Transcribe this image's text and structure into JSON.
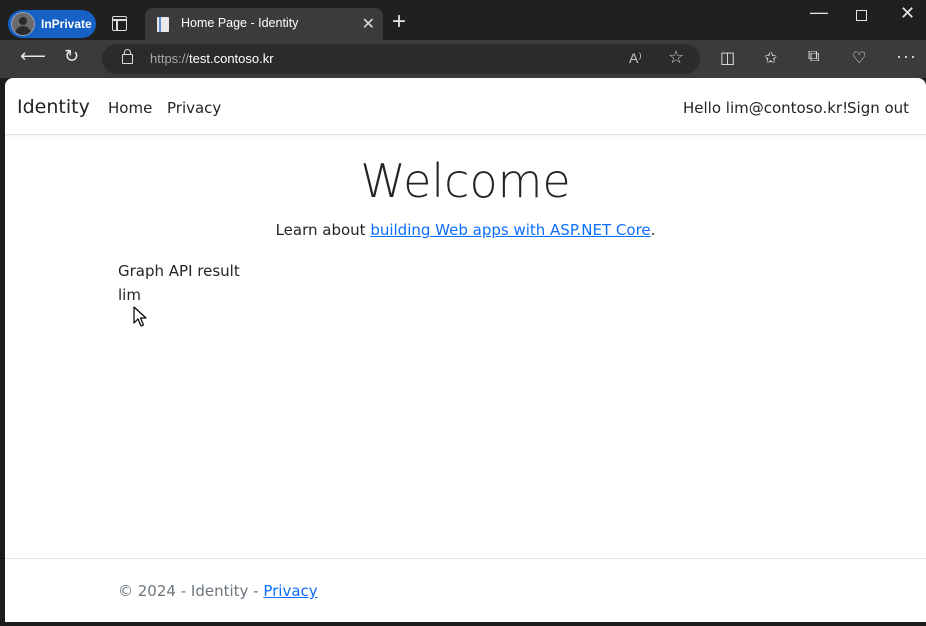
{
  "browser": {
    "inprivate_label": "InPrivate",
    "tab_title": "Home Page - Identity",
    "url_protocol": "https://",
    "url_host": "test.contoso.kr",
    "read_aloud_glyph": "A⁾"
  },
  "site": {
    "brand": "Identity",
    "nav": {
      "home": "Home",
      "privacy": "Privacy"
    },
    "greeting": "Hello lim@contoso.kr!",
    "signout": "Sign out"
  },
  "main": {
    "heading": "Welcome",
    "learn_prefix": "Learn about ",
    "learn_link": "building Web apps with ASP.NET Core",
    "learn_suffix": ".",
    "graph_label": "Graph API result",
    "graph_value": "lim"
  },
  "footer": {
    "copyright": "© 2024 - Identity - ",
    "privacy_link": "Privacy"
  }
}
